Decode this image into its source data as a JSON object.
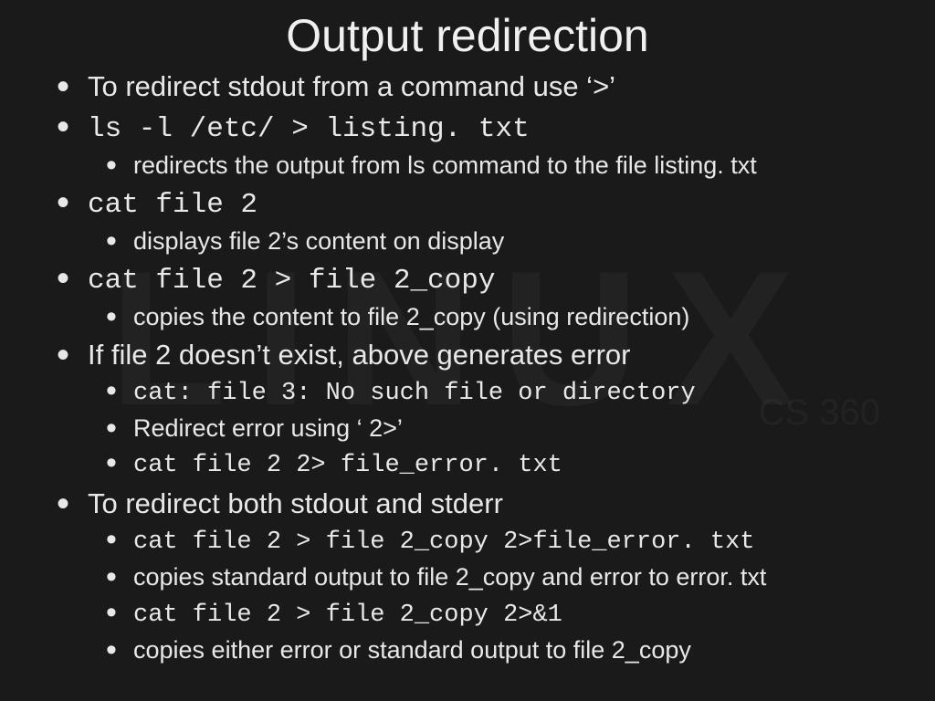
{
  "title": "Output redirection",
  "bullets": {
    "b1": "To redirect stdout from a command use ‘>’",
    "b2": "ls -l /etc/ > listing. txt",
    "b2a": "redirects the output from ls command to the file listing. txt",
    "b3": "cat file 2",
    "b3a": "displays file 2’s content on display",
    "b4": "cat file 2 > file 2_copy",
    "b4a": "copies the content to file 2_copy (using redirection)",
    "b5": "If file 2 doesn’t exist, above generates error",
    "b5a": "cat: file 3: No such file or directory",
    "b5b": "Redirect error using ‘ 2>’",
    "b5c": "cat file 2 2> file_error. txt",
    "b6": "To redirect both stdout and stderr",
    "b6a": "cat file 2 > file 2_copy 2>file_error. txt",
    "b6b": "copies standard output to file 2_copy and error to error. txt",
    "b6c": "cat file 2 > file 2_copy 2>&1",
    "b6d": "copies either error or standard output to file 2_copy"
  }
}
